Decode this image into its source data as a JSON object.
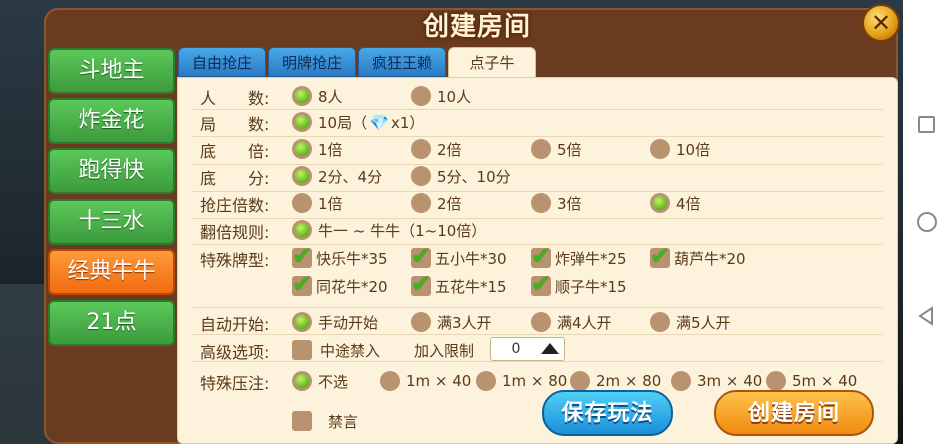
{
  "dialog": {
    "title": "创建房间",
    "close_icon": "close-icon"
  },
  "games": [
    {
      "label": "斗地主",
      "active": false
    },
    {
      "label": "炸金花",
      "active": false
    },
    {
      "label": "跑得快",
      "active": false
    },
    {
      "label": "十三水",
      "active": false
    },
    {
      "label": "经典牛牛",
      "active": true
    },
    {
      "label": "21点",
      "active": false
    }
  ],
  "tabs": [
    {
      "label": "自由抢庄",
      "active": false
    },
    {
      "label": "明牌抢庄",
      "active": false
    },
    {
      "label": "疯狂王赖",
      "active": false
    },
    {
      "label": "点子牛",
      "active": true
    }
  ],
  "rows": {
    "players": {
      "label": "人　　数:",
      "options": [
        "8人",
        "10人"
      ],
      "selected": "8人"
    },
    "rounds": {
      "label": "局　　数:",
      "option_prefix": "10局（",
      "option_suffix": "x1）",
      "gem_icon": "diamond-icon"
    },
    "multiple": {
      "label": "底　　倍:",
      "options": [
        "1倍",
        "2倍",
        "5倍",
        "10倍"
      ],
      "selected": "1倍"
    },
    "base_score": {
      "label": "底　　分:",
      "options": [
        "2分、4分",
        "5分、10分"
      ],
      "selected": "2分、4分"
    },
    "banker_multiple": {
      "label": "抢庄倍数:",
      "options": [
        "1倍",
        "2倍",
        "3倍",
        "4倍"
      ],
      "selected": "4倍"
    },
    "double_rule": {
      "label": "翻倍规则:",
      "option": "牛一 ~ 牛牛（1~10倍）"
    },
    "special_types": {
      "label": "特殊牌型:",
      "options": [
        "快乐牛*35",
        "五小牛*30",
        "炸弹牛*25",
        "葫芦牛*20",
        "同花牛*20",
        "五花牛*15",
        "顺子牛*15"
      ]
    },
    "auto_start": {
      "label": "自动开始:",
      "options": [
        "手动开始",
        "满3人开",
        "满4人开",
        "满5人开"
      ],
      "selected": "手动开始"
    },
    "advanced": {
      "label": "高级选项:",
      "no_join": "中途禁入",
      "join_limit_label": "加入限制",
      "join_limit_value": "0"
    },
    "special_bet": {
      "label": "特殊压注:",
      "options": [
        "不选",
        "1m × 40",
        "1m × 80",
        "2m × 80",
        "3m × 40",
        "5m × 40"
      ],
      "selected": "不选"
    },
    "ban_chat": "禁言"
  },
  "buttons": {
    "save": "保存玩法",
    "create": "创建房间"
  },
  "colors": {
    "accent_green": "#5cb81c",
    "active_orange": "#f06a10",
    "panel_bg": "#fdf3dc",
    "frame_brown": "#6b3b1f"
  }
}
